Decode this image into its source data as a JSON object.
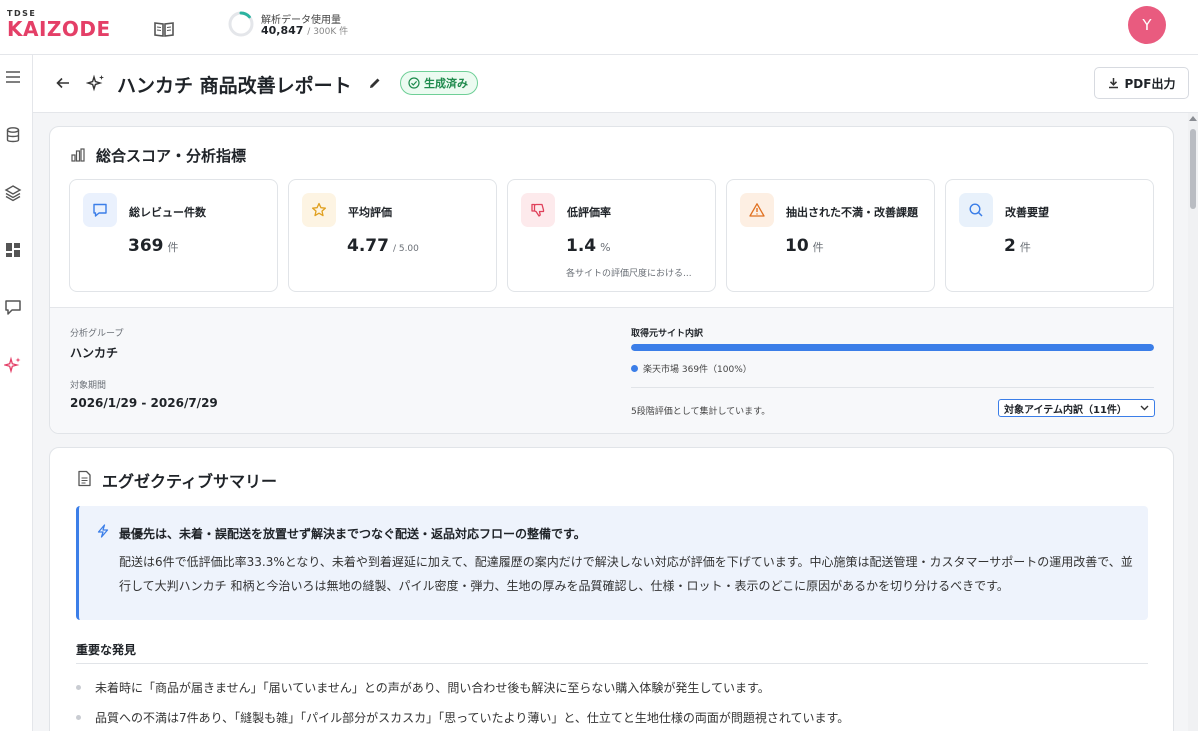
{
  "app": {
    "logo_top": "TDSE",
    "logo_main": "KAIZODE",
    "usage_label": "解析データ使用量",
    "usage_value": "40,847",
    "usage_cap": "/ 300K 件",
    "usage_fraction": 0.136,
    "avatar_initial": "Y",
    "accent_color": "#e43f67"
  },
  "rail": {
    "icons": [
      "menu-icon",
      "database-icon",
      "layers-icon",
      "dashboard-icon",
      "chat-icon",
      "sparkle-icon"
    ]
  },
  "header": {
    "title": "ハンカチ 商品改善レポート",
    "status": "生成済み",
    "pdf_label": "PDF出力"
  },
  "metrics": {
    "title": "総合スコア・分析指標",
    "cards": [
      {
        "label": "総レビュー件数",
        "value": "369",
        "unit": "件",
        "note": "",
        "icon": "chat-bubble-icon"
      },
      {
        "label": "平均評価",
        "value": "4.77",
        "unit": "/ 5.00",
        "note": "",
        "icon": "star-icon"
      },
      {
        "label": "低評価率",
        "value": "1.4",
        "unit": "%",
        "note": "各サイトの評価尺度における...",
        "icon": "thumbs-down-icon"
      },
      {
        "label": "抽出された不満・改善課題",
        "value": "10",
        "unit": "件",
        "note": "",
        "icon": "warning-icon"
      },
      {
        "label": "改善要望",
        "value": "2",
        "unit": "件",
        "note": "",
        "icon": "search-icon"
      }
    ]
  },
  "meta": {
    "group_label": "分析グループ",
    "group_value": "ハンカチ",
    "period_label": "対象期間",
    "period_value": "2026/1/29 - 2026/7/29",
    "source_title": "取得元サイト内訳",
    "source_legend": "楽天市場 369件（100%）",
    "source_fraction": 1.0,
    "note": "5段階評価として集計しています。",
    "select_value": "対象アイテム内訳（11件）"
  },
  "summary": {
    "title": "エグゼクティブサマリー",
    "headline": "最優先は、未着・誤配送を放置せず解決までつなぐ配送・返品対応フローの整備です。",
    "body": "配送は6件で低評価比率33.3%となり、未着や到着遅延に加えて、配達履歴の案内だけで解決しない対応が評価を下げています。中心施策は配送管理・カスタマーサポートの運用改善で、並行して大判ハンカチ 和柄と今治いろは無地の縫製、パイル密度・弾力、生地の厚みを品質確認し、仕様・ロット・表示のどこに原因があるかを切り分けるべきです。",
    "findings_title": "重要な発見",
    "findings": [
      "未着時に「商品が届きません」「届いていません」との声があり、問い合わせ後も解決に至らない購入体験が発生しています。",
      "品質への不満は7件あり、「縫製も雑」「パイル部分がスカスカ」「思っていたより薄い」と、仕立てと生地仕様の両面が問題視されています。"
    ]
  }
}
